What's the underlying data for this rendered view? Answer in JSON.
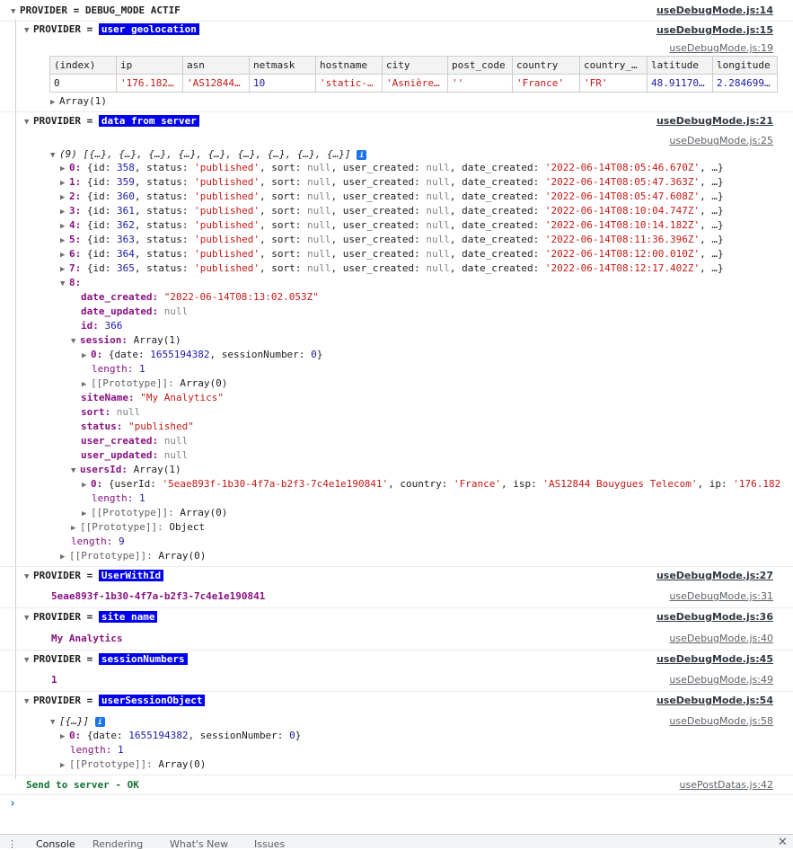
{
  "groups": {
    "debug": {
      "prefix": "PROVIDER = DEBUG_MODE ACTIF",
      "src": "useDebugMode.js:14"
    },
    "geo": {
      "prefix": "PROVIDER = ",
      "label": "user geolocation",
      "src": "useDebugMode.js:15",
      "table_src": "useDebugMode.js:19"
    },
    "server": {
      "prefix": "PROVIDER = ",
      "label": "data from server",
      "src": "useDebugMode.js:21",
      "array_src": "useDebugMode.js:25"
    },
    "userwithid": {
      "prefix": "PROVIDER = ",
      "label": "UserWithId",
      "src": "useDebugMode.js:27",
      "value": "5eae893f-1b30-4f7a-b2f3-7c4e1e190841",
      "value_src": "useDebugMode.js:31"
    },
    "sitename": {
      "prefix": "PROVIDER = ",
      "label": "site name",
      "src": "useDebugMode.js:36",
      "value": "My Analytics",
      "value_src": "useDebugMode.js:40"
    },
    "sessionnumbers": {
      "prefix": "PROVIDER = ",
      "label": "sessionNumbers",
      "src": "useDebugMode.js:45",
      "value": "1",
      "value_src": "useDebugMode.js:49"
    },
    "usersession": {
      "prefix": "PROVIDER = ",
      "label": "userSessionObject",
      "src": "useDebugMode.js:54",
      "array_src": "useDebugMode.js:58"
    }
  },
  "geo_table": {
    "headers": [
      "(index)",
      "ip",
      "asn",
      "netmask",
      "hostname",
      "city",
      "post_code",
      "country",
      "country_…",
      "latitude",
      "longitude"
    ],
    "row": [
      "0",
      "'176.182…",
      "'AS12844…",
      "10",
      "'static-…",
      "'Asnière…",
      "''",
      "'France'",
      "'FR'",
      "48.91170…",
      "2.284699…"
    ],
    "array_label": "Array(1)"
  },
  "server_array": {
    "summary": "(9) [{…}, {…}, {…}, {…}, {…}, {…}, {…}, {…}, {…}]",
    "items": [
      {
        "idx": "0:",
        "id": "358",
        "date": "'2022-06-14T08:05:46.670Z'"
      },
      {
        "idx": "1:",
        "id": "359",
        "date": "'2022-06-14T08:05:47.363Z'"
      },
      {
        "idx": "2:",
        "id": "360",
        "date": "'2022-06-14T08:05:47.608Z'"
      },
      {
        "idx": "3:",
        "id": "361",
        "date": "'2022-06-14T08:10:04.747Z'"
      },
      {
        "idx": "4:",
        "id": "362",
        "date": "'2022-06-14T08:10:14.182Z'"
      },
      {
        "idx": "5:",
        "id": "363",
        "date": "'2022-06-14T08:11:36.396Z'"
      },
      {
        "idx": "6:",
        "id": "364",
        "date": "'2022-06-14T08:12:00.010Z'"
      },
      {
        "idx": "7:",
        "id": "365",
        "date": "'2022-06-14T08:12:17.402Z'"
      }
    ],
    "item_prefix": "{id: ",
    "item_mid": ", status: ",
    "item_status": "'published'",
    "item_mid2": ", sort: ",
    "item_null": "null",
    "item_mid3": ", user_created: ",
    "item_mid4": ", date_created: ",
    "item_end": ", …}",
    "expanded": {
      "idx": "8:",
      "date_created_key": "date_created:",
      "date_created": "\"2022-06-14T08:13:02.053Z\"",
      "date_updated_key": "date_updated:",
      "date_updated": "null",
      "id_key": "id:",
      "id": "366",
      "session_key": "session:",
      "session_val": "Array(1)",
      "session_item": "0:",
      "session_item_text": "{date: ",
      "session_date": "1655194382",
      "session_mid": ", sessionNumber: ",
      "session_num": "0",
      "session_close": "}",
      "length_key": "length:",
      "session_length": "1",
      "proto_key": "[[Prototype]]:",
      "proto_array": "Array(0)",
      "sitename_key": "siteName:",
      "sitename": "\"My Analytics\"",
      "sort_key": "sort:",
      "sort": "null",
      "status_key": "status:",
      "status": "\"published\"",
      "user_created_key": "user_created:",
      "user_created": "null",
      "user_updated_key": "user_updated:",
      "user_updated": "null",
      "usersid_key": "usersId:",
      "usersid_val": "Array(1)",
      "usersid_item_text": "{userId: ",
      "usersid_userid": "'5eae893f-1b30-4f7a-b2f3-7c4e1e190841'",
      "usersid_mid": ", country: ",
      "usersid_country": "'France'",
      "usersid_mid2": ", isp: ",
      "usersid_isp": "'AS12844 Bouygues Telecom'",
      "usersid_mid3": ", ip: ",
      "usersid_ip": "'176.182",
      "usersid_length": "1",
      "proto_object": "Object"
    },
    "length": "9",
    "proto_array": "Array(0)"
  },
  "user_session_array": {
    "summary": "[{…}]",
    "item_idx": "0:",
    "item_text": "{date: ",
    "date": "1655194382",
    "mid": ", sessionNumber: ",
    "num": "0",
    "close": "}",
    "length": "1",
    "proto": "Array(0)"
  },
  "send_line": {
    "text": "Send to server - OK",
    "src": "usePostDatas.js:42"
  },
  "prompt": "›",
  "drawer_tabs": [
    "Console",
    "Rendering",
    "What's New",
    "Issues"
  ]
}
